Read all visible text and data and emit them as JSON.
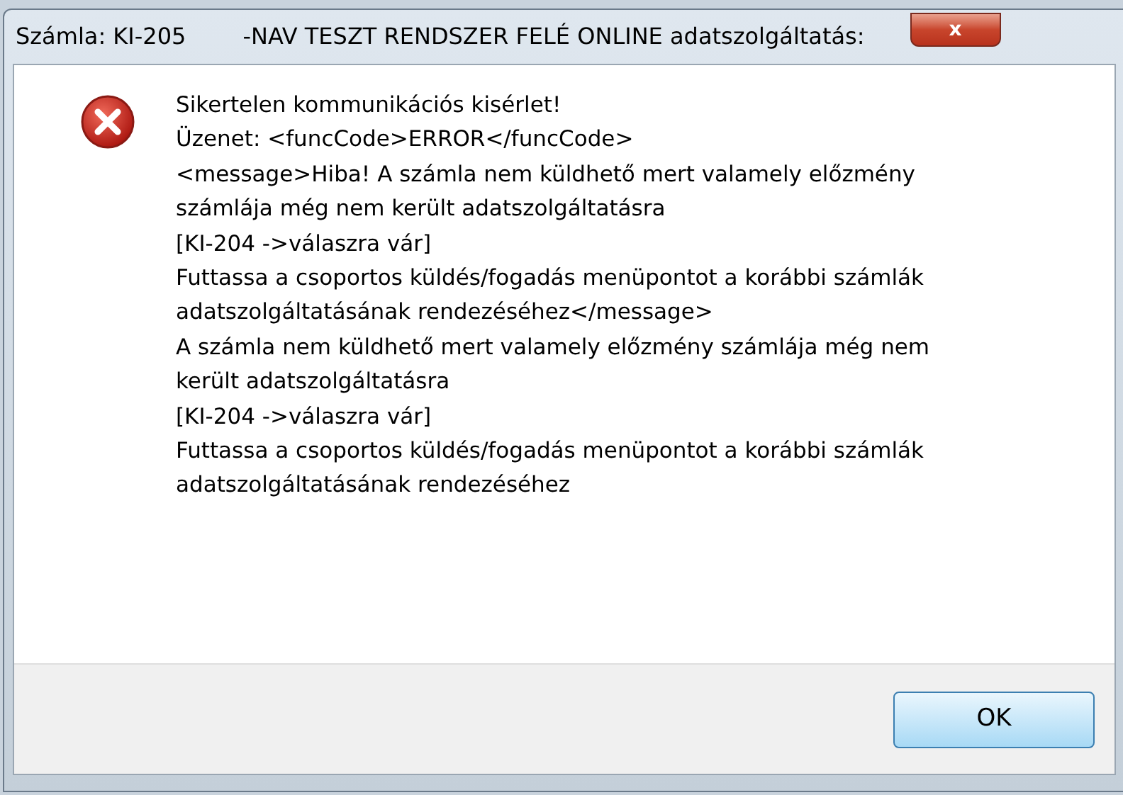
{
  "window": {
    "title": "Számla: KI-205",
    "subtitle": "-NAV TESZT RENDSZER FELÉ ONLINE adatszolgáltatás:",
    "close_label": "x"
  },
  "message": {
    "lines": [
      "Sikertelen kommunikációs kisérlet!",
      "Üzenet: <funcCode>ERROR</funcCode>",
      "<message>Hiba! A számla nem küldhető mert valamely előzmény",
      "számlája még nem került adatszolgáltatásra",
      "[KI-204 ->válaszra vár]",
      "Futtassa a csoportos küldés/fogadás menüpontot a korábbi számlák",
      "adatszolgáltatásának rendezéséhez</message>",
      "A számla nem küldhető mert valamely előzmény számlája még nem",
      "került adatszolgáltatásra",
      "[KI-204 ->válaszra vár]",
      "Futtassa a csoportos küldés/fogadás menüpontot a korábbi számlák",
      "adatszolgáltatásának rendezéséhez"
    ]
  },
  "buttons": [
    "OK"
  ]
}
